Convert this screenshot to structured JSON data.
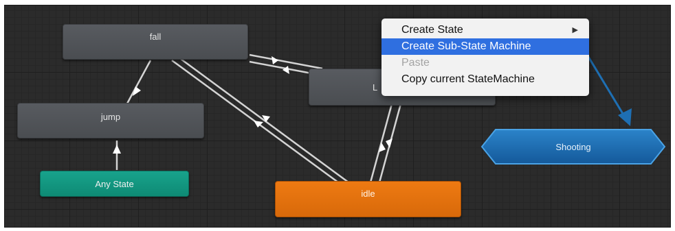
{
  "states": {
    "fall": "fall",
    "jump": "jump",
    "any_state": "Any State",
    "idle": "idle",
    "partial_state_label": "L",
    "shooting": "Shooting"
  },
  "context_menu": {
    "items": [
      {
        "label": "Create State",
        "has_submenu": true,
        "submenu_glyph": "▶"
      },
      {
        "label": "Create Sub-State Machine",
        "highlighted": true
      },
      {
        "label": "Paste",
        "disabled": true
      },
      {
        "label": "Copy current StateMachine"
      }
    ]
  },
  "colors": {
    "canvas": "#2b2b2b",
    "state_default": "#525559",
    "any_state": "#13977f",
    "default_state": "#e3700c",
    "sub_state_machine": "#1f6fb2",
    "menu_highlight": "#2f6fe0",
    "annotation_arrow": "#1e6fb3"
  }
}
